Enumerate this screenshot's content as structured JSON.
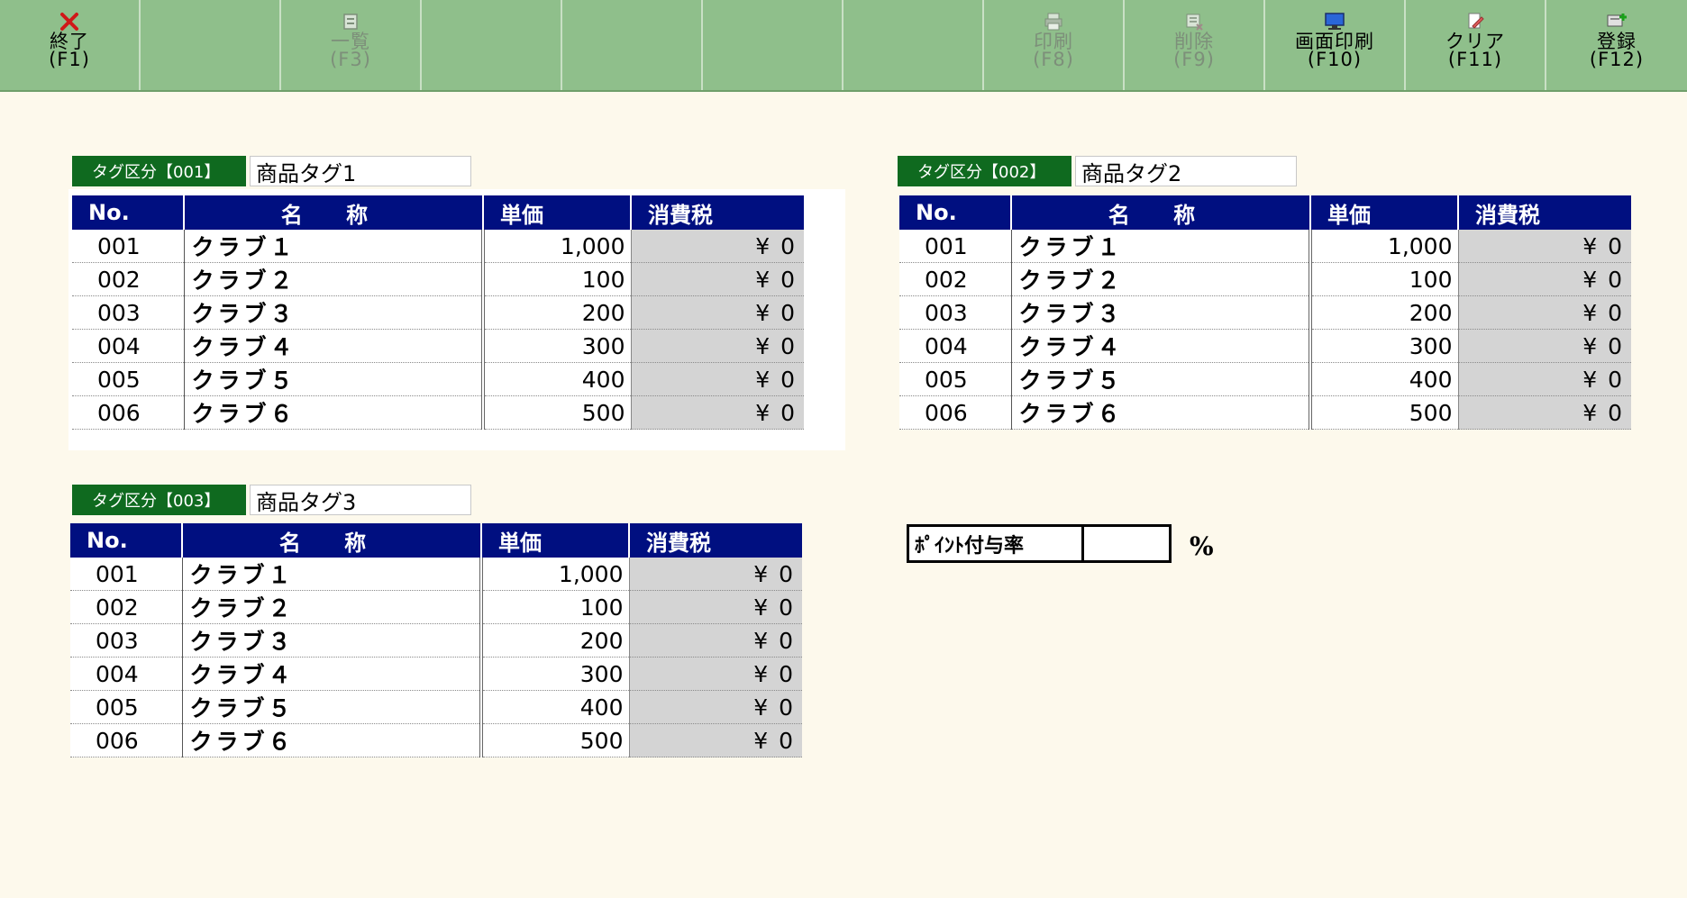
{
  "toolbar": [
    {
      "label": "終了",
      "key": "(F1)",
      "icon": "close-icon",
      "enabled": true
    },
    {
      "label": "",
      "key": "",
      "icon": "",
      "enabled": false
    },
    {
      "label": "一覧",
      "key": "(F3)",
      "icon": "list-icon",
      "enabled": false
    },
    {
      "label": "",
      "key": "",
      "icon": "",
      "enabled": false
    },
    {
      "label": "",
      "key": "",
      "icon": "",
      "enabled": false
    },
    {
      "label": "",
      "key": "",
      "icon": "",
      "enabled": false
    },
    {
      "label": "",
      "key": "",
      "icon": "",
      "enabled": false
    },
    {
      "label": "印刷",
      "key": "(F8)",
      "icon": "printer-icon",
      "enabled": false
    },
    {
      "label": "削除",
      "key": "(F9)",
      "icon": "delete-icon",
      "enabled": false
    },
    {
      "label": "画面印刷",
      "key": "(F10)",
      "icon": "monitor-icon",
      "enabled": true
    },
    {
      "label": "クリア",
      "key": "(F11)",
      "icon": "eraser-icon",
      "enabled": true
    },
    {
      "label": "登録",
      "key": "(F12)",
      "icon": "register-icon",
      "enabled": true
    }
  ],
  "columns": {
    "no": "No.",
    "name": "名 称",
    "price": "単価",
    "tax": "消費税"
  },
  "tags": [
    {
      "label": "タグ区分【001】",
      "name": "商品タグ1",
      "rows": [
        {
          "no": "001",
          "name": "クラブ１",
          "price": "1,000",
          "tax": "¥ 0"
        },
        {
          "no": "002",
          "name": "クラブ２",
          "price": "100",
          "tax": "¥ 0"
        },
        {
          "no": "003",
          "name": "クラブ３",
          "price": "200",
          "tax": "¥ 0"
        },
        {
          "no": "004",
          "name": "クラブ４",
          "price": "300",
          "tax": "¥ 0"
        },
        {
          "no": "005",
          "name": "クラブ５",
          "price": "400",
          "tax": "¥ 0"
        },
        {
          "no": "006",
          "name": "クラブ６",
          "price": "500",
          "tax": "¥ 0"
        }
      ]
    },
    {
      "label": "タグ区分【002】",
      "name": "商品タグ2",
      "rows": [
        {
          "no": "001",
          "name": "クラブ１",
          "price": "1,000",
          "tax": "¥ 0"
        },
        {
          "no": "002",
          "name": "クラブ２",
          "price": "100",
          "tax": "¥ 0"
        },
        {
          "no": "003",
          "name": "クラブ３",
          "price": "200",
          "tax": "¥ 0"
        },
        {
          "no": "004",
          "name": "クラブ４",
          "price": "300",
          "tax": "¥ 0"
        },
        {
          "no": "005",
          "name": "クラブ５",
          "price": "400",
          "tax": "¥ 0"
        },
        {
          "no": "006",
          "name": "クラブ６",
          "price": "500",
          "tax": "¥ 0"
        }
      ]
    },
    {
      "label": "タグ区分【003】",
      "name": "商品タグ3",
      "rows": [
        {
          "no": "001",
          "name": "クラブ１",
          "price": "1,000",
          "tax": "¥ 0"
        },
        {
          "no": "002",
          "name": "クラブ２",
          "price": "100",
          "tax": "¥ 0"
        },
        {
          "no": "003",
          "name": "クラブ３",
          "price": "200",
          "tax": "¥ 0"
        },
        {
          "no": "004",
          "name": "クラブ４",
          "price": "300",
          "tax": "¥ 0"
        },
        {
          "no": "005",
          "name": "クラブ５",
          "price": "400",
          "tax": "¥ 0"
        },
        {
          "no": "006",
          "name": "クラブ６",
          "price": "500",
          "tax": "¥ 0"
        }
      ]
    }
  ],
  "point": {
    "label": "ﾎﾟｲﾝﾄ付与率",
    "value": "",
    "unit": "%"
  },
  "colors": {
    "toolbar": "#8fbf8b",
    "tag_label": "#0f6a1f",
    "header": "#000f80",
    "tax_cell": "#d4d4d4",
    "background": "#fdf9ec"
  }
}
